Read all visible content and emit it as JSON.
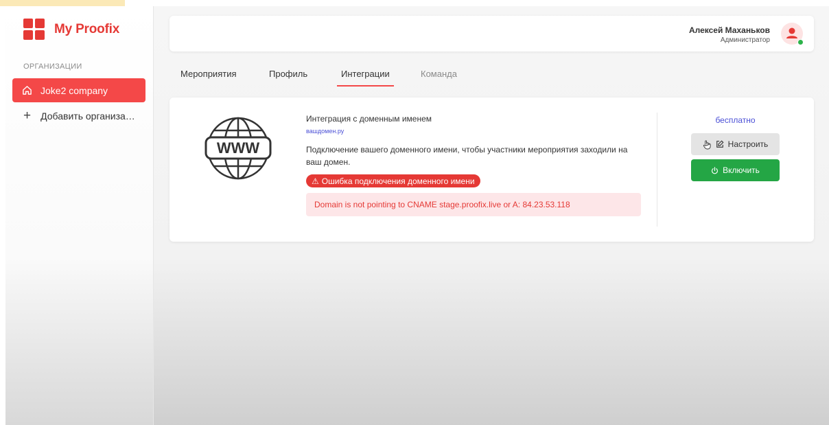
{
  "app": {
    "name": "My Proofix"
  },
  "sidebar": {
    "section_label": "ОРГАНИЗАЦИИ",
    "organizations": [
      {
        "label": "Joke2 company",
        "active": true
      }
    ],
    "add_label": "Добавить организа…"
  },
  "header": {
    "user_name": "Алексей Маханьков",
    "user_role": "Администратор"
  },
  "tabs": [
    {
      "label": "Мероприятия",
      "active": false
    },
    {
      "label": "Профиль",
      "active": false
    },
    {
      "label": "Интеграции",
      "active": true
    },
    {
      "label": "Команда",
      "active": false
    }
  ],
  "integration": {
    "title": "Интеграция с доменным именем",
    "domain_placeholder": "вашдомен.ру",
    "description": "Подключение вашего доменного имени, чтобы участники мероприятия заходили на ваш домен.",
    "error_badge": "Ошибка подключения доменного имени",
    "error_detail": "Domain is not pointing to CNAME stage.proofix.live or A: 84.23.53.118",
    "price": "бесплатно",
    "configure_label": "Настроить",
    "enable_label": "Включить",
    "icon_text": "WWW"
  },
  "colors": {
    "brand": "#e53935",
    "active_item": "#f44848",
    "link": "#4a4fd6",
    "success": "#24a645",
    "online": "#2cb34a"
  },
  "icons": [
    "logo-icon",
    "home-icon",
    "plus-icon",
    "avatar-icon",
    "globe-www-icon",
    "warning-icon",
    "edit-icon",
    "cursor-hand-icon",
    "power-icon"
  ]
}
